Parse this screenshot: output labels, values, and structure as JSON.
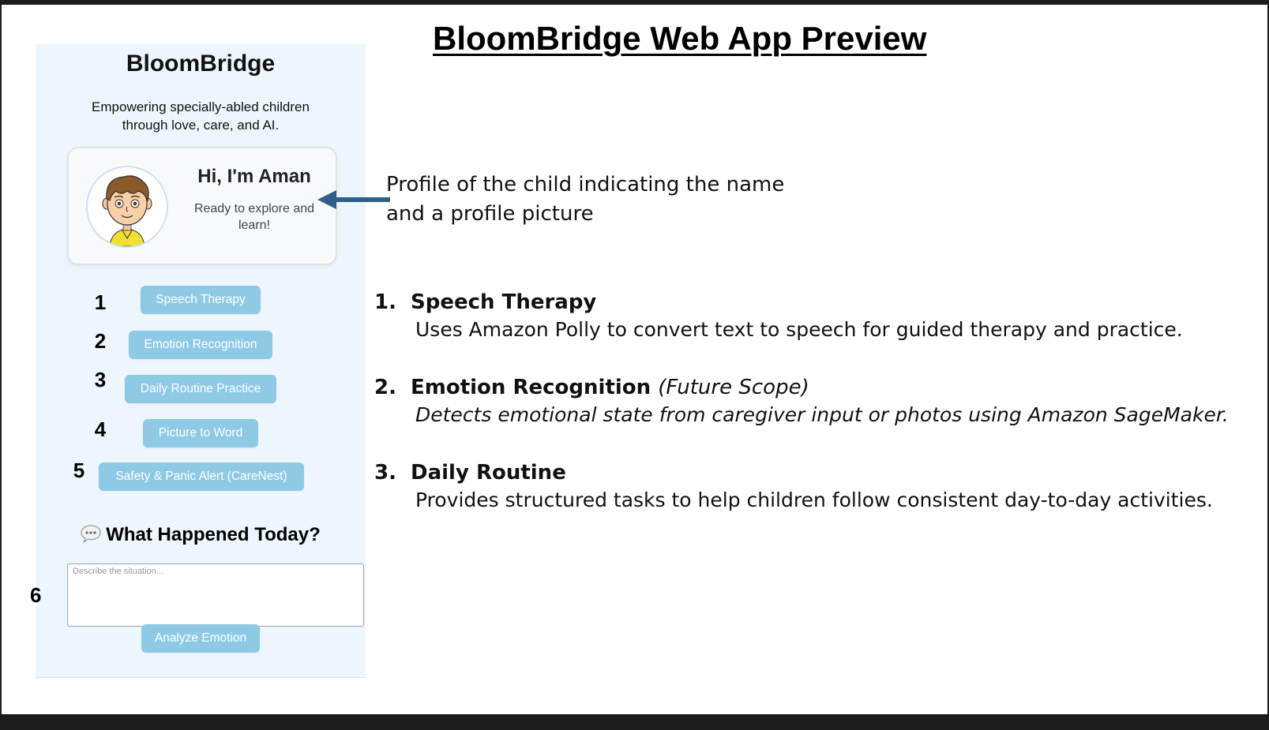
{
  "slide_title": "BloomBridge Web App Preview",
  "app": {
    "name": "BloomBridge",
    "tagline": "Empowering specially-abled children through love, care, and AI.",
    "profile": {
      "greeting": "Hi, I'm Aman",
      "subtext": "Ready to explore and learn!"
    },
    "features": [
      {
        "number": "1",
        "label": "Speech Therapy"
      },
      {
        "number": "2",
        "label": "Emotion Recognition"
      },
      {
        "number": "3",
        "label": "Daily Routine Practice"
      },
      {
        "number": "4",
        "label": "Picture to Word"
      },
      {
        "number": "5",
        "label": "Safety & Panic Alert (CareNest)"
      }
    ],
    "what_happened": {
      "heading": "What Happened Today?",
      "number": "6",
      "input_placeholder": "Describe the situation...",
      "analyze_button": "Analyze Emotion"
    }
  },
  "callout": "Profile of the child indicating the name and a profile picture",
  "descriptions": [
    {
      "num": "1.",
      "title": "Speech Therapy",
      "scope": "",
      "body": "Uses Amazon Polly to convert text to speech for guided therapy and practice.",
      "body_italic": false
    },
    {
      "num": "2.",
      "title": "Emotion Recognition",
      "scope": "(Future Scope)",
      "body": "Detects emotional state from caregiver input or photos using Amazon SageMaker.",
      "body_italic": true
    },
    {
      "num": "3.",
      "title": "Daily Routine",
      "scope": "",
      "body": "Provides structured tasks to help children follow consistent day-to-day activities.",
      "body_italic": false
    }
  ],
  "colors": {
    "panel_bg": "#eef6fd",
    "button_bg": "#8ecae6",
    "button_text": "#ffffff",
    "arrow": "#2f5f86"
  },
  "icons": {
    "chat": "speech-bubble-icon",
    "avatar": "boy-avatar-icon",
    "arrow": "left-arrow-icon"
  }
}
